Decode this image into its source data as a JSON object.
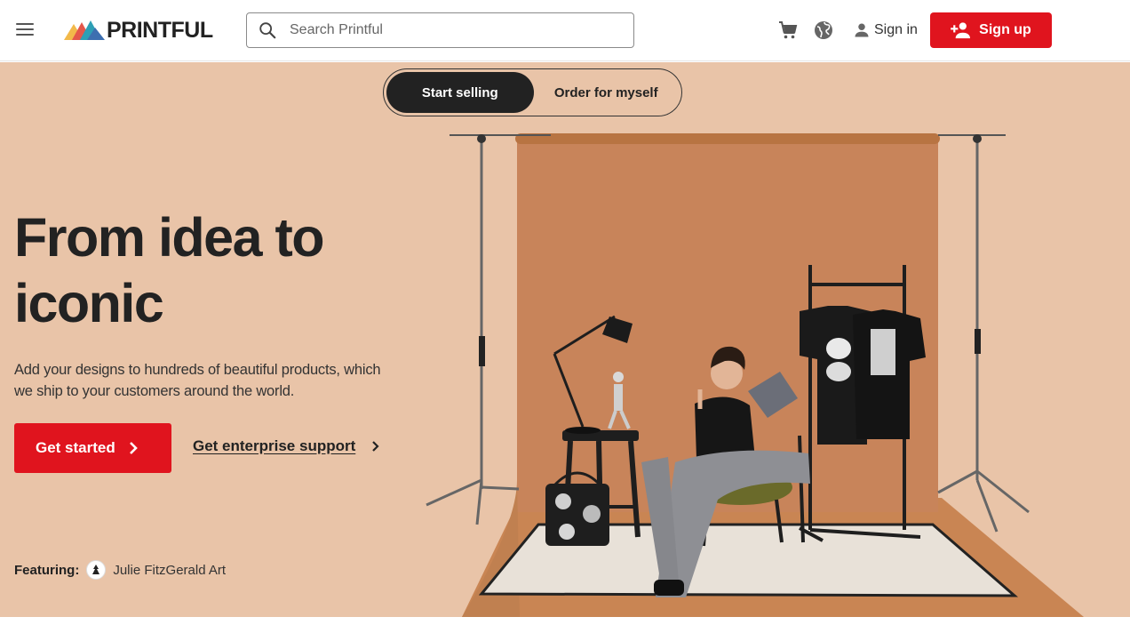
{
  "header": {
    "logo_text": "PRINTFUL",
    "search_placeholder": "Search Printful",
    "signin_label": "Sign in",
    "signup_label": "Sign up",
    "icons": [
      "menu-icon",
      "search-icon",
      "cart-icon",
      "globe-icon",
      "person-icon",
      "add-person-icon"
    ]
  },
  "hero": {
    "toggle": {
      "active_label": "Start selling",
      "inactive_label": "Order for myself"
    },
    "headline_line1": "From idea to",
    "headline_line2": "iconic",
    "subtitle": "Add your designs to hundreds of beautiful products, which we ship to your customers around the world.",
    "cta_label": "Get started",
    "enterprise_label": "Get enterprise support",
    "featuring_label": "Featuring:",
    "featuring_name": "Julie FitzGerald Art"
  },
  "colors": {
    "brand_red": "#e0141e",
    "hero_bg": "#e9c4a8",
    "backdrop": "#c8845a",
    "dark": "#222222"
  }
}
